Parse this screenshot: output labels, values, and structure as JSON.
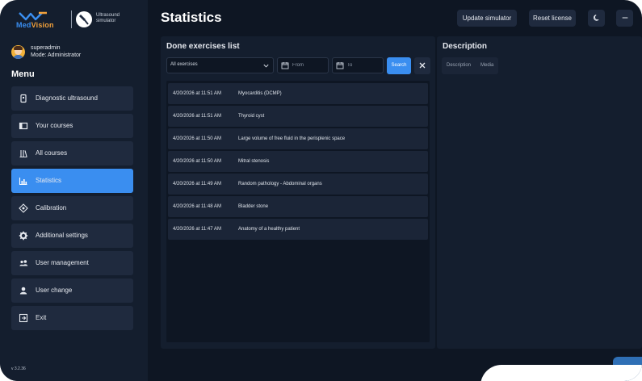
{
  "brand": {
    "name_part1": "Med",
    "name_part2": "Vision",
    "app_name_line1": "Ultrasound",
    "app_name_line2": "simulator",
    "logo_icon": "medvision-logo-icon",
    "app_icon": "ultrasound-probe-icon"
  },
  "user": {
    "name": "superadmin",
    "mode": "Mode: Administrator",
    "avatar_icon": "avatar-icon"
  },
  "menu": {
    "title": "Menu",
    "items": [
      {
        "label": "Diagnostic ultrasound",
        "icon": "probe-icon",
        "active": false
      },
      {
        "label": "Your courses",
        "icon": "book-icon",
        "active": false
      },
      {
        "label": "All courses",
        "icon": "library-icon",
        "active": false
      },
      {
        "label": "Statistics",
        "icon": "bar-chart-icon",
        "active": true
      },
      {
        "label": "Calibration",
        "icon": "crosshair-icon",
        "active": false
      },
      {
        "label": "Additional settings",
        "icon": "gear-icon",
        "active": false
      },
      {
        "label": "User management",
        "icon": "users-icon",
        "active": false
      },
      {
        "label": "User change",
        "icon": "user-icon",
        "active": false
      },
      {
        "label": "Exit",
        "icon": "exit-icon",
        "active": false
      }
    ]
  },
  "version": "v 3.2.36",
  "header": {
    "title": "Statistics",
    "update_label": "Update simulator",
    "reset_label": "Reset license",
    "theme_icon": "moon-icon",
    "minimize_icon": "minimize-icon"
  },
  "exercises": {
    "title": "Done exercises list",
    "filter": {
      "selected": "All exercises",
      "chevron_icon": "chevron-down-icon"
    },
    "from_placeholder": "From",
    "to_placeholder": "To",
    "calendar_icon": "calendar-icon",
    "search_label": "Search",
    "clear_icon": "close-icon",
    "rows": [
      {
        "date": "4/20/2026 at 11:51 AM",
        "name": "Myocarditis (DCMP)"
      },
      {
        "date": "4/20/2026 at 11:51 AM",
        "name": "Thyroid cyst"
      },
      {
        "date": "4/20/2026 at 11:50 AM",
        "name": "Large volume of free fluid in the perisplenic space"
      },
      {
        "date": "4/20/2026 at 11:50 AM",
        "name": "Mitral stenosis"
      },
      {
        "date": "4/20/2026 at 11:49 AM",
        "name": "Random pathology - Abdominal organs"
      },
      {
        "date": "4/20/2026 at 11:48 AM",
        "name": "Bladder stone"
      },
      {
        "date": "4/20/2026 at 11:47 AM",
        "name": "Anatomy of a healthy patient"
      }
    ]
  },
  "description": {
    "title": "Description",
    "tabs": [
      "Description",
      "Media"
    ]
  },
  "colors": {
    "background": "#0e1623",
    "sidebar": "#141e2e",
    "accent": "#3a8ef0",
    "item": "#1f2a3e"
  }
}
